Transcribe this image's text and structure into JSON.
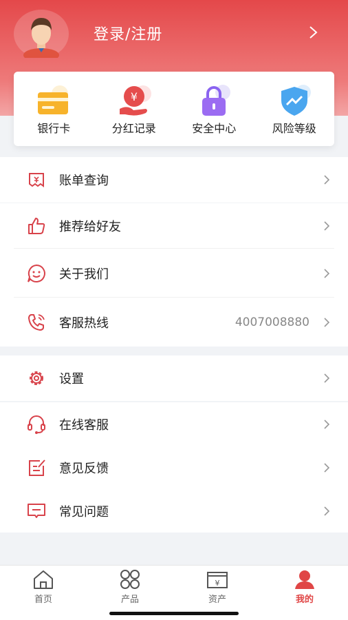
{
  "header": {
    "login_text": "登录/注册"
  },
  "quick_actions": [
    {
      "label": "银行卡",
      "icon": "bank-card-icon"
    },
    {
      "label": "分红记录",
      "icon": "dividend-icon"
    },
    {
      "label": "安全中心",
      "icon": "lock-icon"
    },
    {
      "label": "风险等级",
      "icon": "shield-chart-icon"
    }
  ],
  "group1": [
    {
      "label": "账单查询",
      "icon": "bill-icon"
    },
    {
      "label": "推荐给好友",
      "icon": "thumbs-up-icon"
    },
    {
      "label": "关于我们",
      "icon": "smile-chat-icon"
    },
    {
      "label": "客服热线",
      "icon": "phone-icon",
      "value": "4007008880"
    }
  ],
  "group2": [
    {
      "label": "设置",
      "icon": "gear-icon"
    },
    {
      "label": "在线客服",
      "icon": "headset-icon"
    },
    {
      "label": "意见反馈",
      "icon": "feedback-icon"
    },
    {
      "label": "常见问题",
      "icon": "faq-icon"
    }
  ],
  "tabbar": [
    {
      "label": "首页",
      "icon": "home-icon",
      "active": false
    },
    {
      "label": "产品",
      "icon": "products-icon",
      "active": false
    },
    {
      "label": "资产",
      "icon": "assets-icon",
      "active": false
    },
    {
      "label": "我的",
      "icon": "profile-icon",
      "active": true
    }
  ],
  "colors": {
    "brand": "#e4484a",
    "accent": "#e04646",
    "text": "#222222",
    "muted": "#888888"
  }
}
